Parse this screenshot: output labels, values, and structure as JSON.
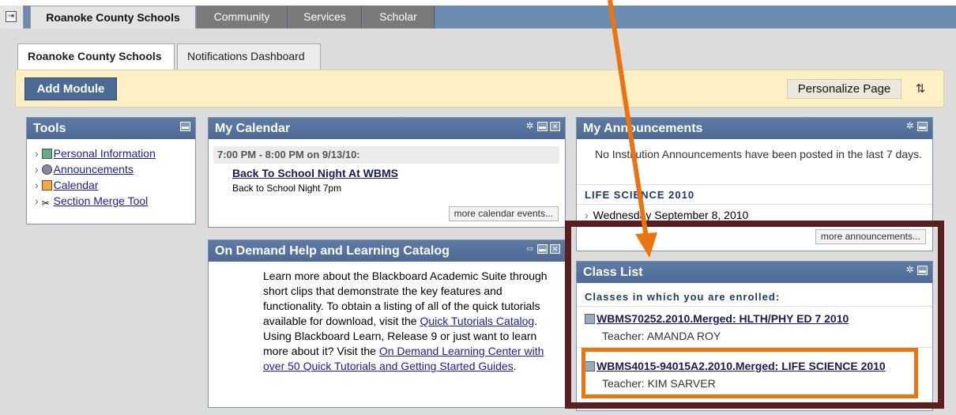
{
  "top_tabs": [
    "Roanoke County Schools",
    "Community",
    "Services",
    "Scholar"
  ],
  "sub_tabs": [
    "Roanoke County Schools",
    "Notifications Dashboard"
  ],
  "toolbar": {
    "add_module": "Add Module",
    "personalize": "Personalize Page"
  },
  "tools": {
    "title": "Tools",
    "items": [
      "Personal Information",
      "Announcements",
      "Calendar",
      "Section Merge Tool"
    ]
  },
  "calendar": {
    "title": "My Calendar",
    "time": "7:00 PM - 8:00 PM on 9/13/10:",
    "event_title": "Back To School Night At WBMS",
    "event_desc": "Back to School Night 7pm",
    "more": "more calendar events..."
  },
  "help": {
    "title": "On Demand Help and Learning Catalog",
    "p1_text": "Learn more about the Blackboard Academic Suite through short clips that demonstrate the key features and functionality. To obtain a listing of all of the quick tutorials available for download, visit the",
    "p1_link": "Quick Tutorials Catalog",
    "p2_text": "Using Blackboard Learn, Release 9 or just want to learn more about it? Visit the",
    "p2_link": "On Demand Learning Center with over 50 Quick Tutorials and Getting Started Guides"
  },
  "announcements": {
    "title": "My Announcements",
    "no_inst": "No Institution Announcements have been posted in the last 7 days.",
    "course": "LIFE SCIENCE 2010",
    "item": "Wednesday September 8, 2010",
    "more": "more announcements..."
  },
  "classlist": {
    "title": "Class List",
    "subtitle": "Classes in which you are enrolled:",
    "courses": [
      {
        "name": "WBMS70252.2010.Merged: HLTH/PHY ED 7 2010",
        "teacher": "Teacher: AMANDA ROY"
      },
      {
        "name": "WBMS4015-94015A2.2010.Merged: LIFE SCIENCE 2010",
        "teacher": "Teacher: KIM SARVER"
      }
    ]
  },
  "colors": {
    "header_blue": "#4d6b95",
    "highlight_orange": "#e87511",
    "highlight_brown": "#5a1e1e"
  }
}
